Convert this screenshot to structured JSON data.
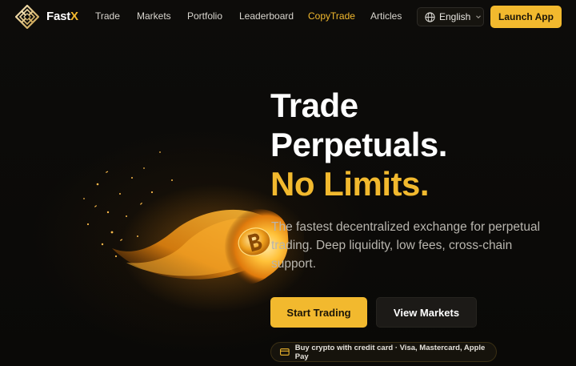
{
  "nav": {
    "brand_part1": "Fast",
    "brand_part2": "X",
    "links": [
      "Trade",
      "Markets",
      "Portfolio",
      "Leaderboard",
      "CopyTrade",
      "Articles"
    ],
    "active_link": "CopyTrade",
    "language": "English",
    "launch_label": "Launch App"
  },
  "hero": {
    "title_line1": "Trade",
    "title_line2": "Perpetuals.",
    "title_line3": "No Limits.",
    "subtitle": "The fastest decentralized exchange for perpetual trading. Deep liquidity, low fees, cross-chain support.",
    "primary_cta": "Start Trading",
    "secondary_cta": "View Markets",
    "pill_text": "Buy crypto with credit card · Visa, Mastercard, Apple Pay"
  },
  "colors": {
    "accent": "#f2b92e",
    "background": "#0b0a08",
    "text": "#ffffff",
    "muted_text": "#b8b5ae"
  },
  "icons": {
    "logo": "fastx-logo-icon",
    "language": "globe-icon",
    "dropdown": "chevron-down-icon",
    "pill": "credit-card-icon",
    "hero_art": "flaming-coin-illustration"
  }
}
